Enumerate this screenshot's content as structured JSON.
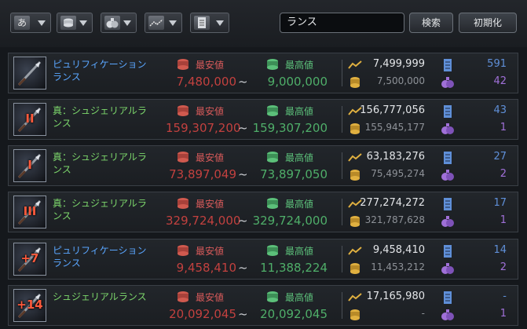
{
  "filters": [
    {
      "name": "grade-filter",
      "icon": "hiragana-a-icon",
      "label": "あ"
    },
    {
      "name": "coin-filter",
      "icon": "coin-stack-icon"
    },
    {
      "name": "bag-filter",
      "icon": "money-bag-icon"
    },
    {
      "name": "trend-filter",
      "icon": "trend-line-icon"
    },
    {
      "name": "scroll-filter",
      "icon": "scroll-icon"
    }
  ],
  "search": {
    "value": "ランス"
  },
  "buttons": {
    "search": "検索",
    "reset": "初期化"
  },
  "labels": {
    "low": "最安値",
    "high": "最高値",
    "tilde": "~"
  },
  "items": [
    {
      "name_line1": "ピュリフィケーション",
      "name_line2": "ランス",
      "name_color": "blue",
      "enhance": "",
      "low": "7,480,000",
      "high": "9,000,000",
      "current": "7,499,999",
      "avg": "7,500,000",
      "count1": "591",
      "count2": "42"
    },
    {
      "name_line1": "真：シュジェリアルラ",
      "name_line2": "ンス",
      "name_color": "green",
      "enhance": "II",
      "low": "159,307,200",
      "high": "159,307,200",
      "current": "156,777,056",
      "avg": "155,945,177",
      "count1": "43",
      "count2": "1"
    },
    {
      "name_line1": "真：シュジェリアルラ",
      "name_line2": "ンス",
      "name_color": "green",
      "enhance": "I",
      "low": "73,897,049",
      "high": "73,897,050",
      "current": "63,183,276",
      "avg": "75,495,274",
      "count1": "27",
      "count2": "2"
    },
    {
      "name_line1": "真：シュジェリアルラ",
      "name_line2": "ンス",
      "name_color": "green",
      "enhance": "III",
      "low": "329,724,000",
      "high": "329,724,000",
      "current": "277,274,272",
      "avg": "321,787,628",
      "count1": "17",
      "count2": "1"
    },
    {
      "name_line1": "ピュリフィケーション",
      "name_line2": "ランス",
      "name_color": "blue",
      "enhance": "+7",
      "low": "9,458,410",
      "high": "11,388,224",
      "current": "9,458,410",
      "avg": "11,453,212",
      "count1": "14",
      "count2": "2"
    },
    {
      "name_line1": "シュジェリアルランス",
      "name_line2": "",
      "name_color": "green",
      "enhance": "+14",
      "low": "20,092,045",
      "high": "20,092,045",
      "current": "17,165,980",
      "avg": "-",
      "count1": "-",
      "count2": "1"
    }
  ],
  "colors": {
    "low": "#c2413f",
    "high": "#4fae69",
    "blue_name": "#5aa6ff",
    "green_name": "#7dd86c"
  }
}
